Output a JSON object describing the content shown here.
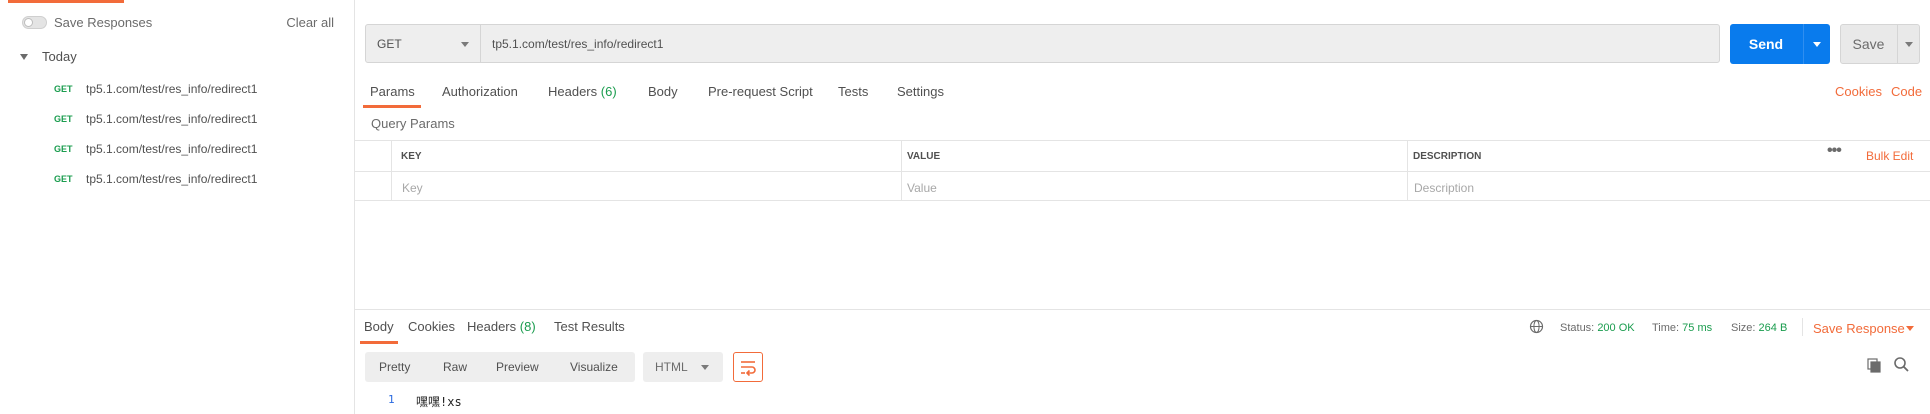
{
  "sidebar": {
    "save_responses_label": "Save Responses",
    "clear_all_label": "Clear all",
    "group_label": "Today",
    "items": [
      {
        "method": "GET",
        "url": "tp5.1.com/test/res_info/redirect1"
      },
      {
        "method": "GET",
        "url": "tp5.1.com/test/res_info/redirect1"
      },
      {
        "method": "GET",
        "url": "tp5.1.com/test/res_info/redirect1"
      },
      {
        "method": "GET",
        "url": "tp5.1.com/test/res_info/redirect1"
      }
    ]
  },
  "request": {
    "method": "GET",
    "url": "tp5.1.com/test/res_info/redirect1",
    "send_label": "Send",
    "save_label": "Save",
    "tabs": {
      "params": "Params",
      "authorization": "Authorization",
      "headers": "Headers",
      "headers_count": "(6)",
      "body": "Body",
      "prerequest": "Pre-request Script",
      "tests": "Tests",
      "settings": "Settings"
    },
    "cookies_link": "Cookies",
    "code_link": "Code",
    "query_params_title": "Query Params",
    "table": {
      "key_header": "KEY",
      "value_header": "VALUE",
      "description_header": "DESCRIPTION",
      "key_placeholder": "Key",
      "value_placeholder": "Value",
      "description_placeholder": "Description",
      "more_label": "•••",
      "bulk_edit_label": "Bulk Edit"
    }
  },
  "response": {
    "tabs": {
      "body": "Body",
      "cookies": "Cookies",
      "headers": "Headers",
      "headers_count": "(8)",
      "test_results": "Test Results"
    },
    "status_label": "Status:",
    "status_value": "200 OK",
    "time_label": "Time:",
    "time_value": "75 ms",
    "size_label": "Size:",
    "size_value": "264 B",
    "save_response_label": "Save Response",
    "format_buttons": {
      "pretty": "Pretty",
      "raw": "Raw",
      "preview": "Preview",
      "visualize": "Visualize"
    },
    "language": "HTML",
    "line_number": "1",
    "body_text": "嘿嘿!xs"
  },
  "colors": {
    "accent": "#f26b3a",
    "send_blue": "#097bed",
    "success_green": "#1a9c4e"
  }
}
